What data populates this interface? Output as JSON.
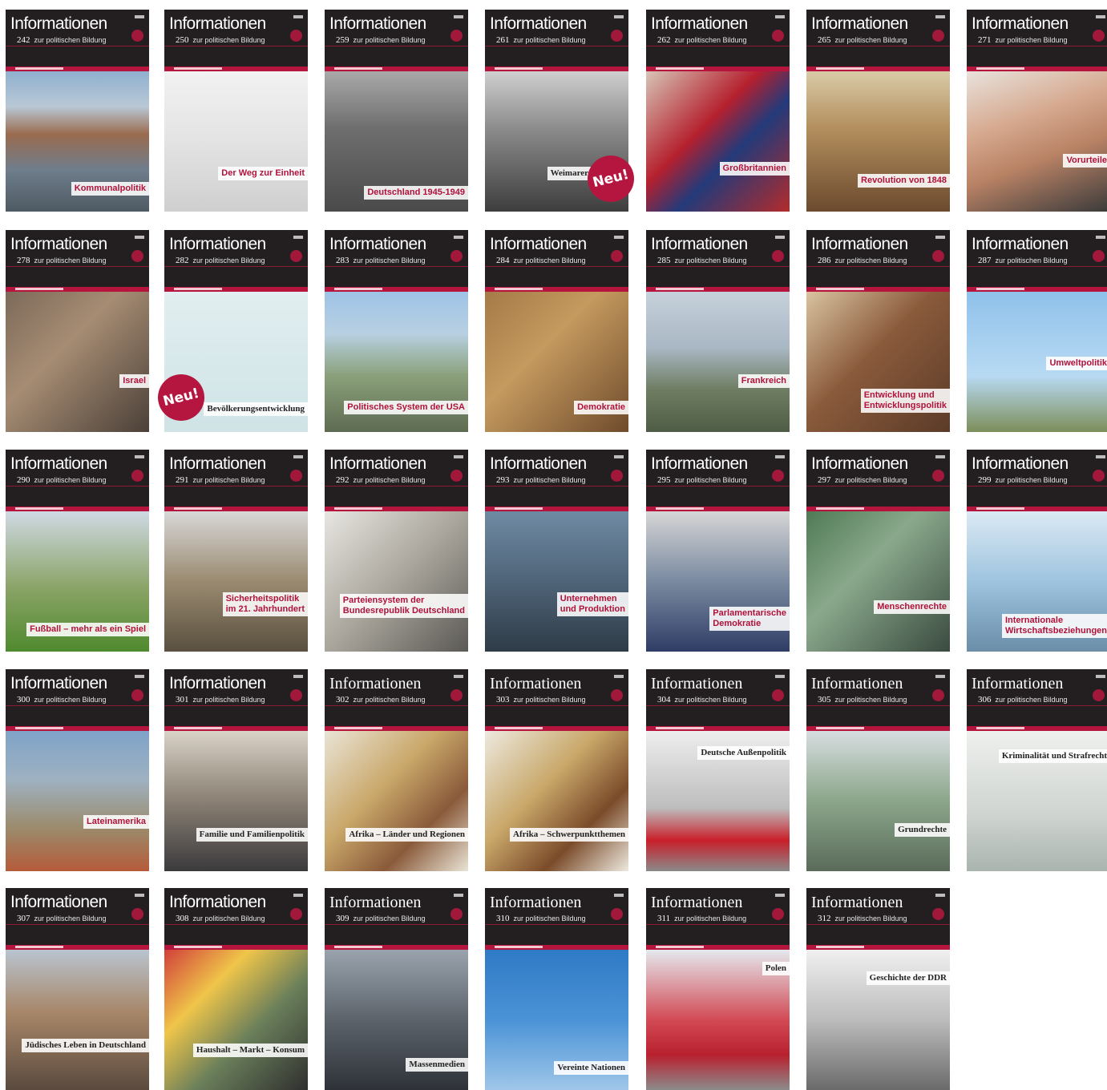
{
  "header_word": "Informationen",
  "header_sub": "zur politischen Bildung",
  "new_badge": "Neu!",
  "covers": [
    {
      "num": "242",
      "title": "Kommunalpolitik"
    },
    {
      "num": "250",
      "title": "Der Weg zur Einheit"
    },
    {
      "num": "259",
      "title": "Deutschland 1945-1949"
    },
    {
      "num": "261",
      "title": "Weimarer Republik",
      "new": true
    },
    {
      "num": "262",
      "title": "Großbritannien"
    },
    {
      "num": "265",
      "title": "Revolution von 1848"
    },
    {
      "num": "271",
      "title": "Vorurteile"
    },
    {
      "num": "278",
      "title": "Israel"
    },
    {
      "num": "282",
      "title": "Bevölkerungsentwicklung",
      "new": true
    },
    {
      "num": "283",
      "title": "Politisches System der USA"
    },
    {
      "num": "284",
      "title": "Demokratie"
    },
    {
      "num": "285",
      "title": "Frankreich"
    },
    {
      "num": "286",
      "title": "Entwicklung und\nEntwicklungspolitik"
    },
    {
      "num": "287",
      "title": "Umweltpolitik"
    },
    {
      "num": "290",
      "title": "Fußball – mehr als ein Spiel"
    },
    {
      "num": "291",
      "title": "Sicherheitspolitik\nim 21. Jahrhundert"
    },
    {
      "num": "292",
      "title": "Parteiensystem der\nBundesrepublik Deutschland"
    },
    {
      "num": "293",
      "title": "Unternehmen\nund Produktion"
    },
    {
      "num": "295",
      "title": "Parlamentarische\nDemokratie"
    },
    {
      "num": "297",
      "title": "Menschenrechte"
    },
    {
      "num": "299",
      "title": "Internationale\nWirtschaftsbeziehungen"
    },
    {
      "num": "300",
      "title": "Lateinamerika"
    },
    {
      "num": "301",
      "title": "Familie und Familienpolitik"
    },
    {
      "num": "302",
      "title": "Afrika – Länder und Regionen"
    },
    {
      "num": "303",
      "title": "Afrika – Schwerpunktthemen"
    },
    {
      "num": "304",
      "title": "Deutsche Außenpolitik"
    },
    {
      "num": "305",
      "title": "Grundrechte"
    },
    {
      "num": "306",
      "title": "Kriminalität und Strafrecht"
    },
    {
      "num": "307",
      "title": "Jüdisches Leben in Deutschland"
    },
    {
      "num": "308",
      "title": "Haushalt – Markt – Konsum"
    },
    {
      "num": "309",
      "title": "Massenmedien"
    },
    {
      "num": "310",
      "title": "Vereinte Nationen"
    },
    {
      "num": "311",
      "title": "Polen"
    },
    {
      "num": "312",
      "title": "Geschichte der DDR"
    }
  ]
}
